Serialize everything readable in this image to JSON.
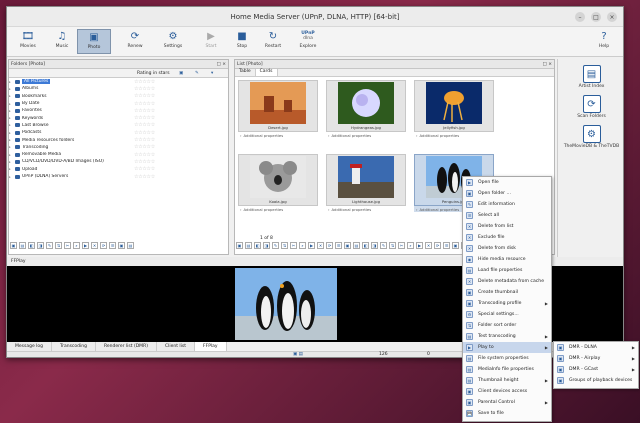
{
  "window": {
    "title": "Home Media Server (UPnP, DLNA, HTTP) [64-bit]"
  },
  "toolbar": {
    "buttons": [
      {
        "label": "Movies",
        "icon": "film-icon"
      },
      {
        "label": "Music",
        "icon": "music-icon"
      },
      {
        "label": "Photo",
        "icon": "photo-icon",
        "active": true
      },
      {
        "label": "Renew",
        "icon": "renew-icon"
      },
      {
        "label": "Settings",
        "icon": "settings-icon"
      },
      {
        "label": "Start",
        "icon": "start-icon",
        "disabled": true
      },
      {
        "label": "Stop",
        "icon": "stop-icon"
      },
      {
        "label": "Restart",
        "icon": "restart-icon"
      },
      {
        "label": "Explore",
        "icon": "explore-icon",
        "upnp": "UPnP",
        "dlna": "dlna"
      },
      {
        "label": "Help",
        "icon": "help-icon"
      }
    ]
  },
  "folders": {
    "title": "Folders [Photo]",
    "rating_header": "Rating in stars",
    "items": [
      {
        "label": "All Pictures",
        "selected": true
      },
      {
        "label": "Albums"
      },
      {
        "label": "Bookmarks"
      },
      {
        "label": "By Date"
      },
      {
        "label": "Favorites"
      },
      {
        "label": "Keywords"
      },
      {
        "label": "Last Browse"
      },
      {
        "label": "Podcasts"
      },
      {
        "label": "Media resources folders"
      },
      {
        "label": "Transcoding"
      },
      {
        "label": "Removable Media"
      },
      {
        "label": "CD/VCD/DVD/DVD-A/BD Images (ISO)"
      },
      {
        "label": "Upload"
      },
      {
        "label": "UPnP (DLNA) Servers"
      }
    ]
  },
  "list": {
    "title": "List [Photo]",
    "tabs": [
      "Table",
      "Cards"
    ],
    "active_tab": "Cards",
    "cards": [
      {
        "file": "Desert.jpg",
        "props": "Additional properties"
      },
      {
        "file": "Hydrangeas.jpg",
        "props": "Additional properties"
      },
      {
        "file": "Jellyfish.jpg",
        "props": "Additional properties"
      },
      {
        "file": "Koala.jpg",
        "props": "Additional properties"
      },
      {
        "file": "Lighthouse.jpg",
        "props": "Additional properties"
      },
      {
        "file": "Penguins.jpg",
        "props": "Additional properties",
        "selected": true
      }
    ],
    "page_indicator": "1 of 8"
  },
  "sidebar": {
    "items": [
      {
        "label": "Artist Index"
      },
      {
        "label": "Scan Folders"
      },
      {
        "label": "TheMovieDB & TheTVDB"
      }
    ]
  },
  "ffplay": {
    "title": "FFPlay"
  },
  "bottom_tabs": [
    "Message log",
    "Transcoding",
    "Renderer list (DMR)",
    "Client list",
    "FFPlay"
  ],
  "bottom_active": "FFPlay",
  "status": {
    "count": "126",
    "zero": "0"
  },
  "context_menu": {
    "items": [
      {
        "label": "Open file"
      },
      {
        "label": "Open folder ..."
      },
      {
        "label": "Edit information"
      },
      {
        "label": "Select all"
      },
      {
        "label": "Delete from list"
      },
      {
        "label": "Exclude file"
      },
      {
        "label": "Delete from disk"
      },
      {
        "label": "Hide media resource"
      },
      {
        "label": "Load file properties"
      },
      {
        "label": "Delete metadata from cache"
      },
      {
        "label": "Create thumbnail"
      },
      {
        "label": "Transcoding profile",
        "submenu": true
      },
      {
        "label": "Special settings..."
      },
      {
        "label": "Folder sort order"
      },
      {
        "label": "Test transcoding",
        "submenu": true
      },
      {
        "label": "Play to",
        "submenu": true,
        "selected": true
      },
      {
        "label": "File system properties"
      },
      {
        "label": "MediaInfo file properties"
      },
      {
        "label": "Thumbnail height",
        "submenu": true
      },
      {
        "label": "Client devices access"
      },
      {
        "label": "Parental Control",
        "submenu": true
      },
      {
        "label": "Save to file"
      }
    ]
  },
  "play_submenu": {
    "items": [
      {
        "label": "DMR - DLNA",
        "submenu": true
      },
      {
        "label": "DMR - Airplay",
        "submenu": true
      },
      {
        "label": "DMR - GCast",
        "submenu": true
      },
      {
        "label": "Groups of playback devices"
      }
    ]
  },
  "colors": {
    "accent": "#3d7ad6",
    "icon_blue": "#2a5d9a",
    "selection": "#c7d6ec"
  }
}
